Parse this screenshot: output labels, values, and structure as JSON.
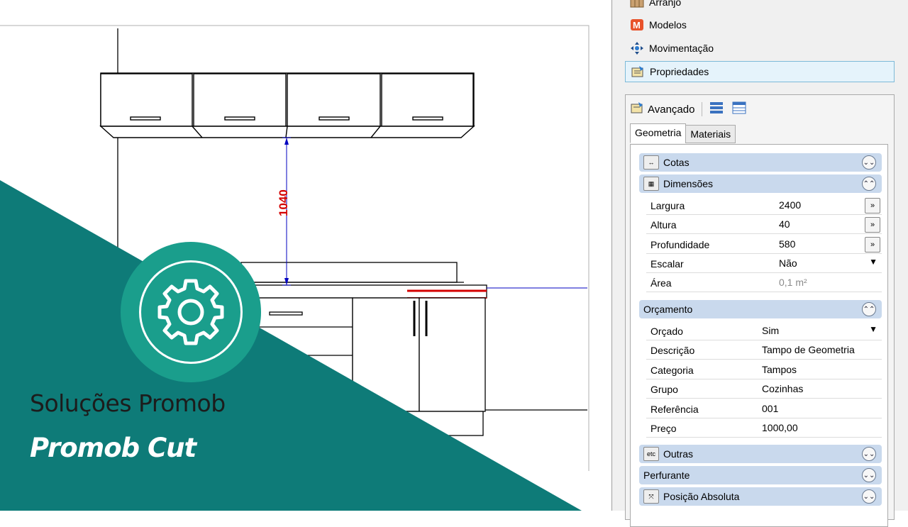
{
  "drawing": {
    "dimension_value": "1040"
  },
  "branding": {
    "title": "Soluções Promob",
    "subtitle": "Promob Cut",
    "colors": {
      "teal": "#0e7b78",
      "badge": "#1a9e8c"
    }
  },
  "sidebar": {
    "items": [
      {
        "label": "Arranjo",
        "icon": "arranjo-icon"
      },
      {
        "label": "Modelos",
        "icon": "modelos-icon"
      },
      {
        "label": "Movimentação",
        "icon": "move-icon"
      },
      {
        "label": "Propriedades",
        "icon": "properties-icon",
        "selected": true
      }
    ]
  },
  "properties": {
    "toolbar_label": "Avançado",
    "tabs": [
      "Geometria",
      "Materiais"
    ],
    "active_tab": "Geometria",
    "sections": {
      "cotas": "Cotas",
      "dimensoes": "Dimensões",
      "orcamento": "Orçamento",
      "outras": "Outras",
      "perfurante": "Perfurante",
      "posicao": "Posição Absoluta"
    },
    "dimensoes_rows": [
      {
        "label": "Largura",
        "value": "2400"
      },
      {
        "label": "Altura",
        "value": "40"
      },
      {
        "label": "Profundidade",
        "value": "580"
      },
      {
        "label": "Escalar",
        "value": "Não"
      },
      {
        "label": "Área",
        "value": "0,1 m²"
      }
    ],
    "orcamento_rows": [
      {
        "label": "Orçado",
        "value": "Sim"
      },
      {
        "label": "Descrição",
        "value": "Tampo de Geometria"
      },
      {
        "label": "Categoria",
        "value": "Tampos"
      },
      {
        "label": "Grupo",
        "value": "Cozinhas"
      },
      {
        "label": "Referência",
        "value": "001"
      },
      {
        "label": "Preço",
        "value": "1000,00"
      }
    ],
    "outras_icon_text": "etc"
  }
}
